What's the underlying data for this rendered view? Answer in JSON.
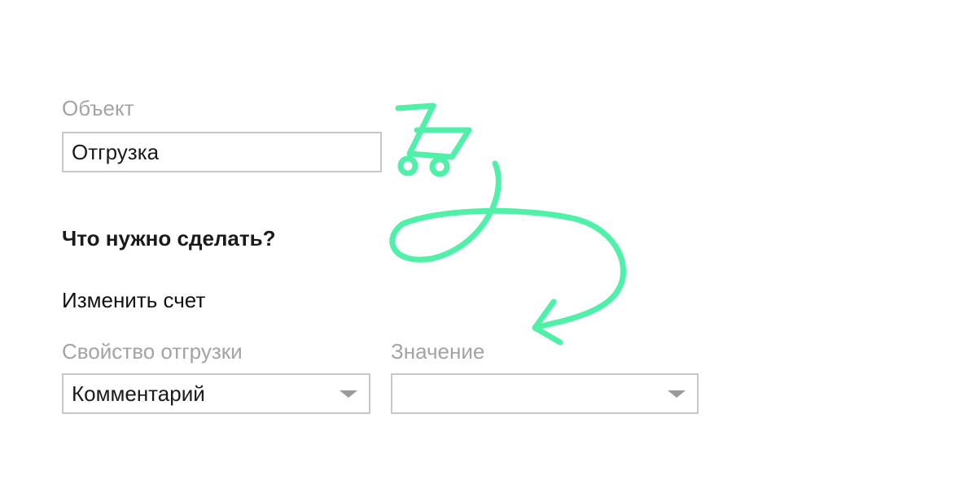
{
  "object_section": {
    "label": "Объект",
    "value": "Отгрузка"
  },
  "question": "Что нужно сделать?",
  "action": "Изменить счет",
  "property": {
    "label": "Свойство отгрузки",
    "selected": "Комментарий"
  },
  "value_field": {
    "label": "Значение",
    "selected": ""
  },
  "icons": {
    "cart": "shopping-cart-icon",
    "arrow": "curved-arrow-icon"
  },
  "colors": {
    "accent": "#4ff0a8",
    "label": "#a3a3a3",
    "border": "#c8c8c8"
  }
}
